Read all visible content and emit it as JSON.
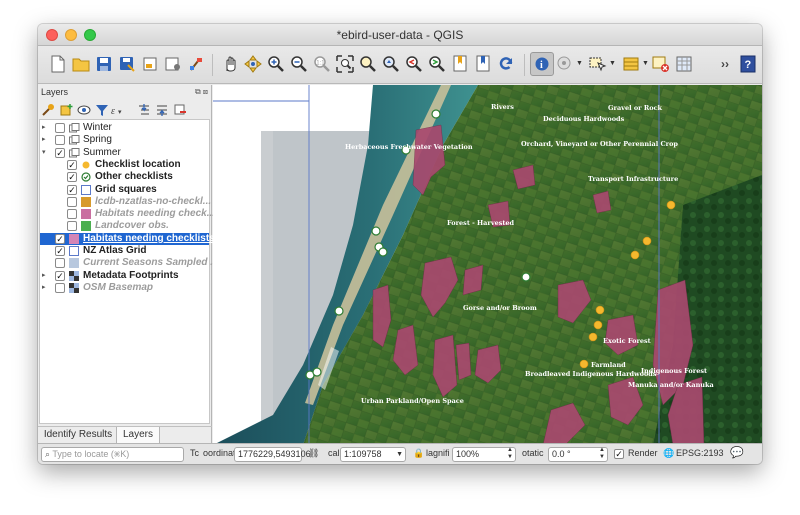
{
  "window": {
    "title": "*ebird-user-data - QGIS"
  },
  "toolbar": {
    "icons": [
      "new-project-icon",
      "open-project-icon",
      "save-project-icon",
      "save-as-icon",
      "new-print-layout-icon",
      "layout-manager-icon",
      "style-manager-icon",
      "pan-icon",
      "pan-to-selection-icon",
      "zoom-in-icon",
      "zoom-out-icon",
      "zoom-native-icon",
      "zoom-full-icon",
      "zoom-to-selection-icon",
      "zoom-to-layer-icon",
      "zoom-last-icon",
      "zoom-next-icon",
      "new-bookmark-icon",
      "show-bookmarks-icon",
      "refresh-icon",
      "identify-icon",
      "measure-icon",
      "select-features-icon",
      "attribute-table-icon",
      "deselect-icon",
      "field-calculator-icon",
      "more-tools-icon",
      "help-icon"
    ]
  },
  "layers_panel": {
    "title": "Layers",
    "tools": [
      "open-styling-icon",
      "add-group-icon",
      "manage-themes-icon",
      "filter-legend-icon",
      "filter-expression-icon",
      "expand-all-icon",
      "collapse-all-icon",
      "remove-layer-icon"
    ],
    "items": [
      {
        "label": "Winter",
        "checked": false,
        "type": "group",
        "expanded": false,
        "depth": 0,
        "style": "normal"
      },
      {
        "label": "Spring",
        "checked": false,
        "type": "group",
        "expanded": false,
        "depth": 0,
        "style": "normal"
      },
      {
        "label": "Summer",
        "checked": true,
        "type": "group",
        "expanded": true,
        "depth": 0,
        "style": "normal"
      },
      {
        "label": "Checklist location",
        "checked": true,
        "type": "point",
        "color": "#f5b82e",
        "depth": 1,
        "style": "bold"
      },
      {
        "label": "Other checklists",
        "checked": true,
        "type": "check",
        "color": "#2e7d32",
        "depth": 1,
        "style": "bold"
      },
      {
        "label": "Grid squares",
        "checked": true,
        "type": "square",
        "color": "#ffffff",
        "depth": 1,
        "style": "bold"
      },
      {
        "label": "lcdb-nzatlas-no-checkl...",
        "checked": false,
        "type": "fill",
        "color": "#d79a2b",
        "depth": 1,
        "style": "italic"
      },
      {
        "label": "Habitats needing check...",
        "checked": false,
        "type": "fill",
        "color": "#c96fa0",
        "depth": 1,
        "style": "italic"
      },
      {
        "label": "Landcover obs.",
        "checked": false,
        "type": "fill",
        "color": "#4caf50",
        "depth": 1,
        "style": "italic"
      },
      {
        "label": "Habitats needing checklists",
        "checked": true,
        "type": "fill",
        "color": "#d385b6",
        "depth": 0,
        "style": "selected"
      },
      {
        "label": "NZ Atlas Grid",
        "checked": true,
        "type": "square",
        "color": "#ffffff",
        "depth": 0,
        "style": "bold"
      },
      {
        "label": "Current Seasons Sampled ...",
        "checked": false,
        "type": "fill",
        "color": "#b8c8de",
        "depth": 0,
        "style": "italic"
      },
      {
        "label": "Metadata Footprints",
        "checked": true,
        "type": "raster",
        "expanded": false,
        "depth": 0,
        "style": "bold"
      },
      {
        "label": "OSM Basemap",
        "checked": false,
        "type": "raster",
        "expanded": false,
        "depth": 0,
        "style": "italic"
      }
    ],
    "tabs": [
      "Identify Results",
      "Layers"
    ],
    "active_tab": "Layers"
  },
  "map": {
    "labels": [
      "Rivers",
      "Deciduous Hardwoods",
      "Gravel or Rock",
      "Herbaceous Freshwater Vegetation",
      "Orchard, Vineyard or Other Perennial Crop",
      "Transport Infrastructure",
      "Forest - Harvested",
      "Gorse and/or Broom",
      "Exotic Forest",
      "Farmland",
      "Broadleaved Indigenous Hardwoods",
      "Indigenous Forest",
      "Manuka and/or Kanuka",
      "Urban Parkland/Open Space"
    ],
    "colors": {
      "habitat": "#a8496e",
      "checklist": "#f5b82e",
      "grid": "#5b79c9"
    }
  },
  "statusbar": {
    "locate_placeholder": "Type to locate (⌘K)",
    "coordinate_label": "oordinat",
    "coordinate_value": "1776229,5493106",
    "scale_label": "cal",
    "scale_value": "1:109758",
    "magnifier_label": "lagnifi",
    "magnifier_value": "100%",
    "rotation_label": "otatic",
    "rotation_value": "0.0 °",
    "render_label": "Render",
    "crs_label": "EPSG:2193",
    "toggle_extents_label": "Tc"
  }
}
